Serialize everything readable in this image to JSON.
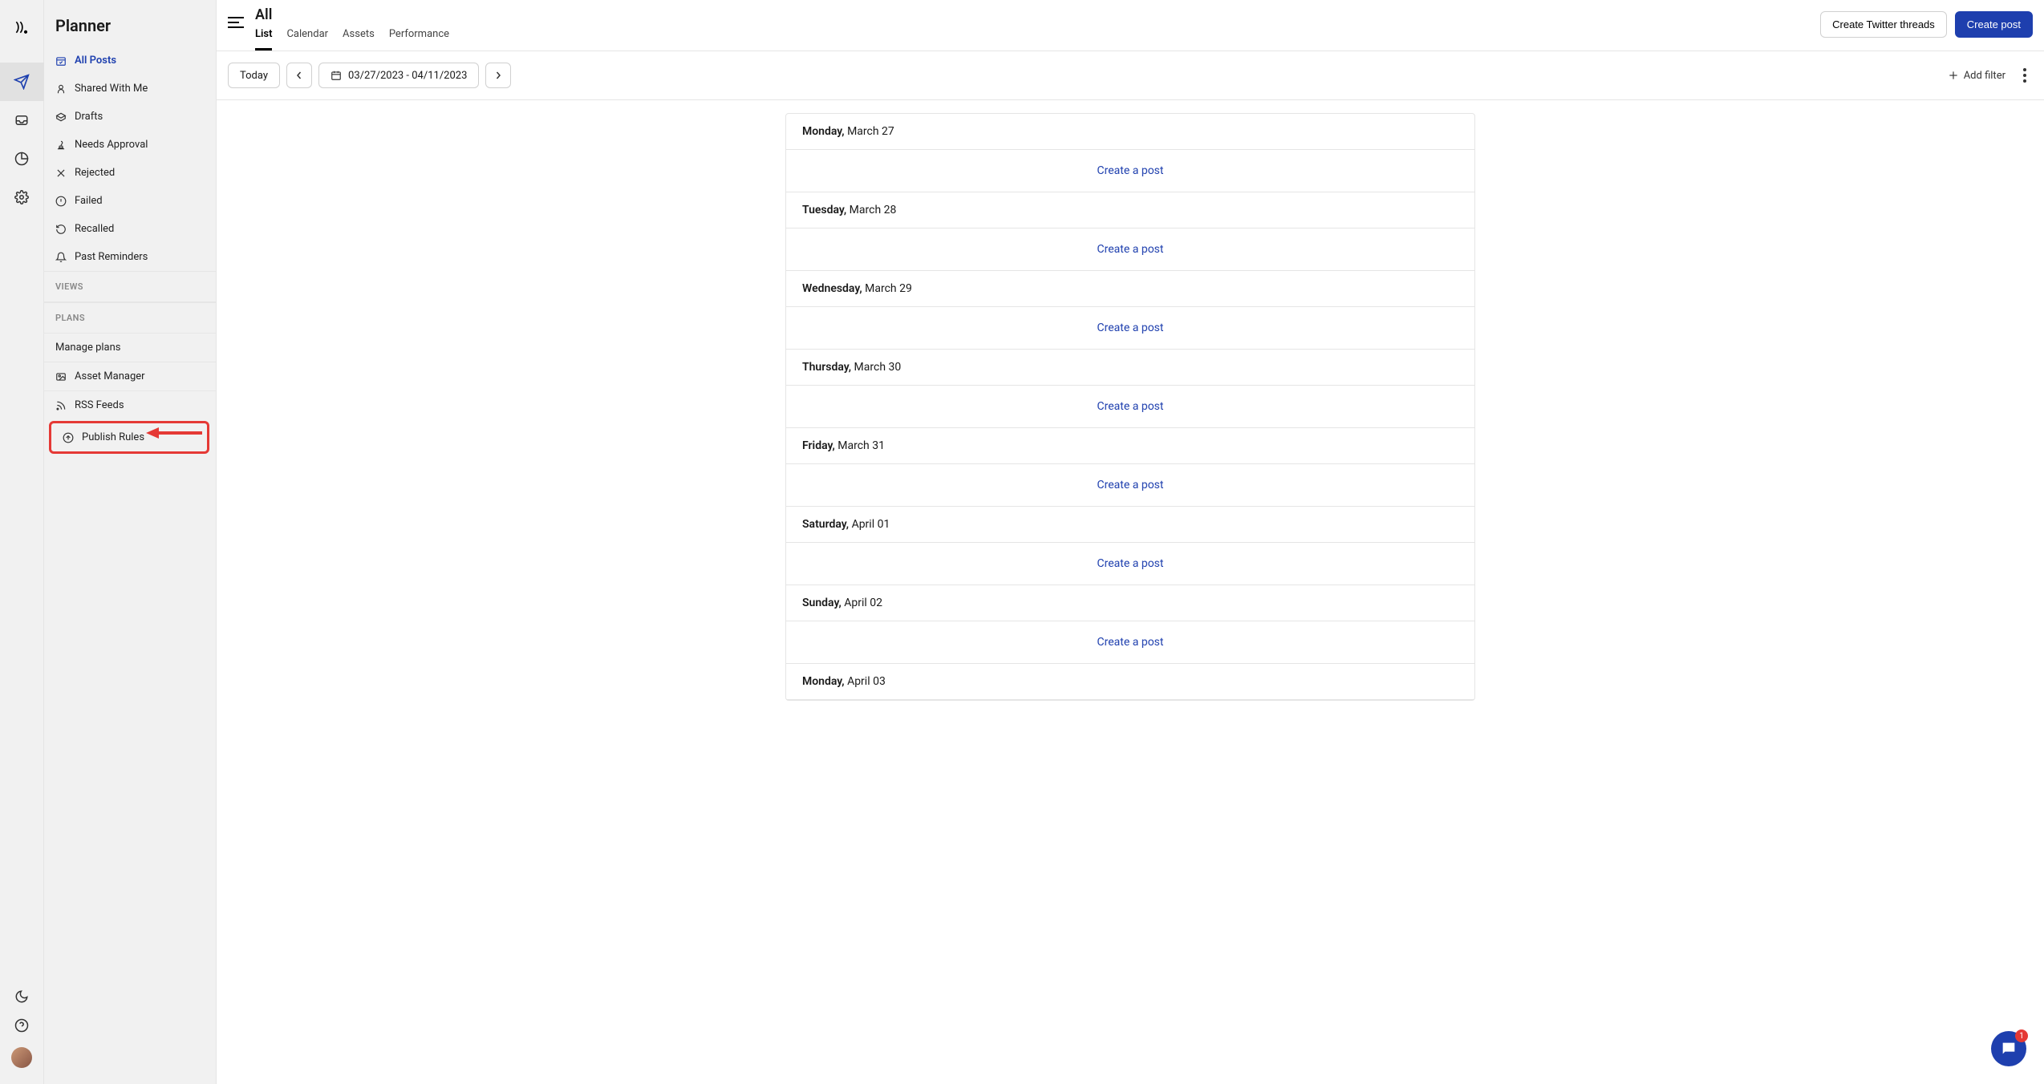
{
  "sidebar": {
    "title": "Planner",
    "items": [
      {
        "label": "All Posts",
        "icon": "calendar-check"
      },
      {
        "label": "Shared With Me",
        "icon": "user"
      },
      {
        "label": "Drafts",
        "icon": "box-open"
      },
      {
        "label": "Needs Approval",
        "icon": "stamp"
      },
      {
        "label": "Rejected",
        "icon": "x"
      },
      {
        "label": "Failed",
        "icon": "alert"
      },
      {
        "label": "Recalled",
        "icon": "undo"
      },
      {
        "label": "Past Reminders",
        "icon": "bell"
      }
    ],
    "views_label": "VIEWS",
    "plans_label": "PLANS",
    "manage_plans": "Manage plans",
    "asset_manager": "Asset Manager",
    "rss_feeds": "RSS Feeds",
    "publish_rules": "Publish Rules"
  },
  "header": {
    "title": "All",
    "tabs": [
      "List",
      "Calendar",
      "Assets",
      "Performance"
    ],
    "create_twitter": "Create Twitter threads",
    "create_post": "Create post"
  },
  "toolbar": {
    "today": "Today",
    "date_range": "03/27/2023 - 04/11/2023",
    "add_filter": "Add filter"
  },
  "days": [
    {
      "dow": "Monday,",
      "date": " March 27"
    },
    {
      "dow": "Tuesday,",
      "date": " March 28"
    },
    {
      "dow": "Wednesday,",
      "date": " March 29"
    },
    {
      "dow": "Thursday,",
      "date": " March 30"
    },
    {
      "dow": "Friday,",
      "date": " March 31"
    },
    {
      "dow": "Saturday,",
      "date": " April 01"
    },
    {
      "dow": "Sunday,",
      "date": " April 02"
    },
    {
      "dow": "Monday,",
      "date": " April 03"
    }
  ],
  "create_a_post": "Create a post",
  "chat_badge": "1"
}
